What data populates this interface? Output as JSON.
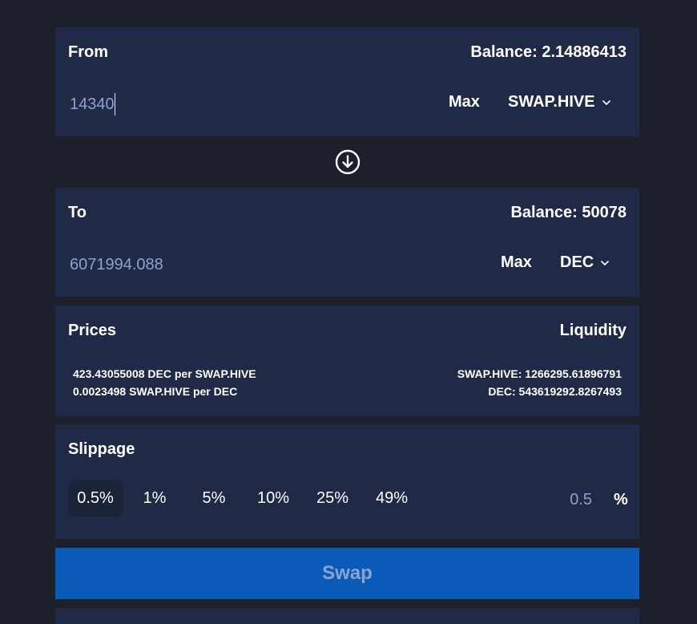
{
  "from": {
    "label": "From",
    "balance": "Balance: 2.14886413",
    "amount": "14340",
    "max_label": "Max",
    "token": "SWAP.HIVE"
  },
  "switch_icon": "arrow-down-circle-icon",
  "to": {
    "label": "To",
    "balance": "Balance: 50078",
    "amount": "6071994.088",
    "max_label": "Max",
    "token": "DEC"
  },
  "prices": {
    "label": "Prices",
    "line1": "423.43055008 DEC per SWAP.HIVE",
    "line2": "0.0023498 SWAP.HIVE per DEC"
  },
  "liquidity": {
    "label": "Liquidity",
    "line1": "SWAP.HIVE: 1266295.61896791",
    "line2": "DEC: 543619292.8267493"
  },
  "slippage": {
    "label": "Slippage",
    "options": [
      "0.5%",
      "1%",
      "5%",
      "10%",
      "25%",
      "49%"
    ],
    "selected_index": 0,
    "custom_value": "0.5",
    "unit": "%"
  },
  "swap_button": {
    "label": "Swap"
  },
  "colors": {
    "background": "#1b202b",
    "card": "#202a46",
    "accent_blue": "#0a5ab8",
    "muted_text": "#8ea2cf"
  }
}
